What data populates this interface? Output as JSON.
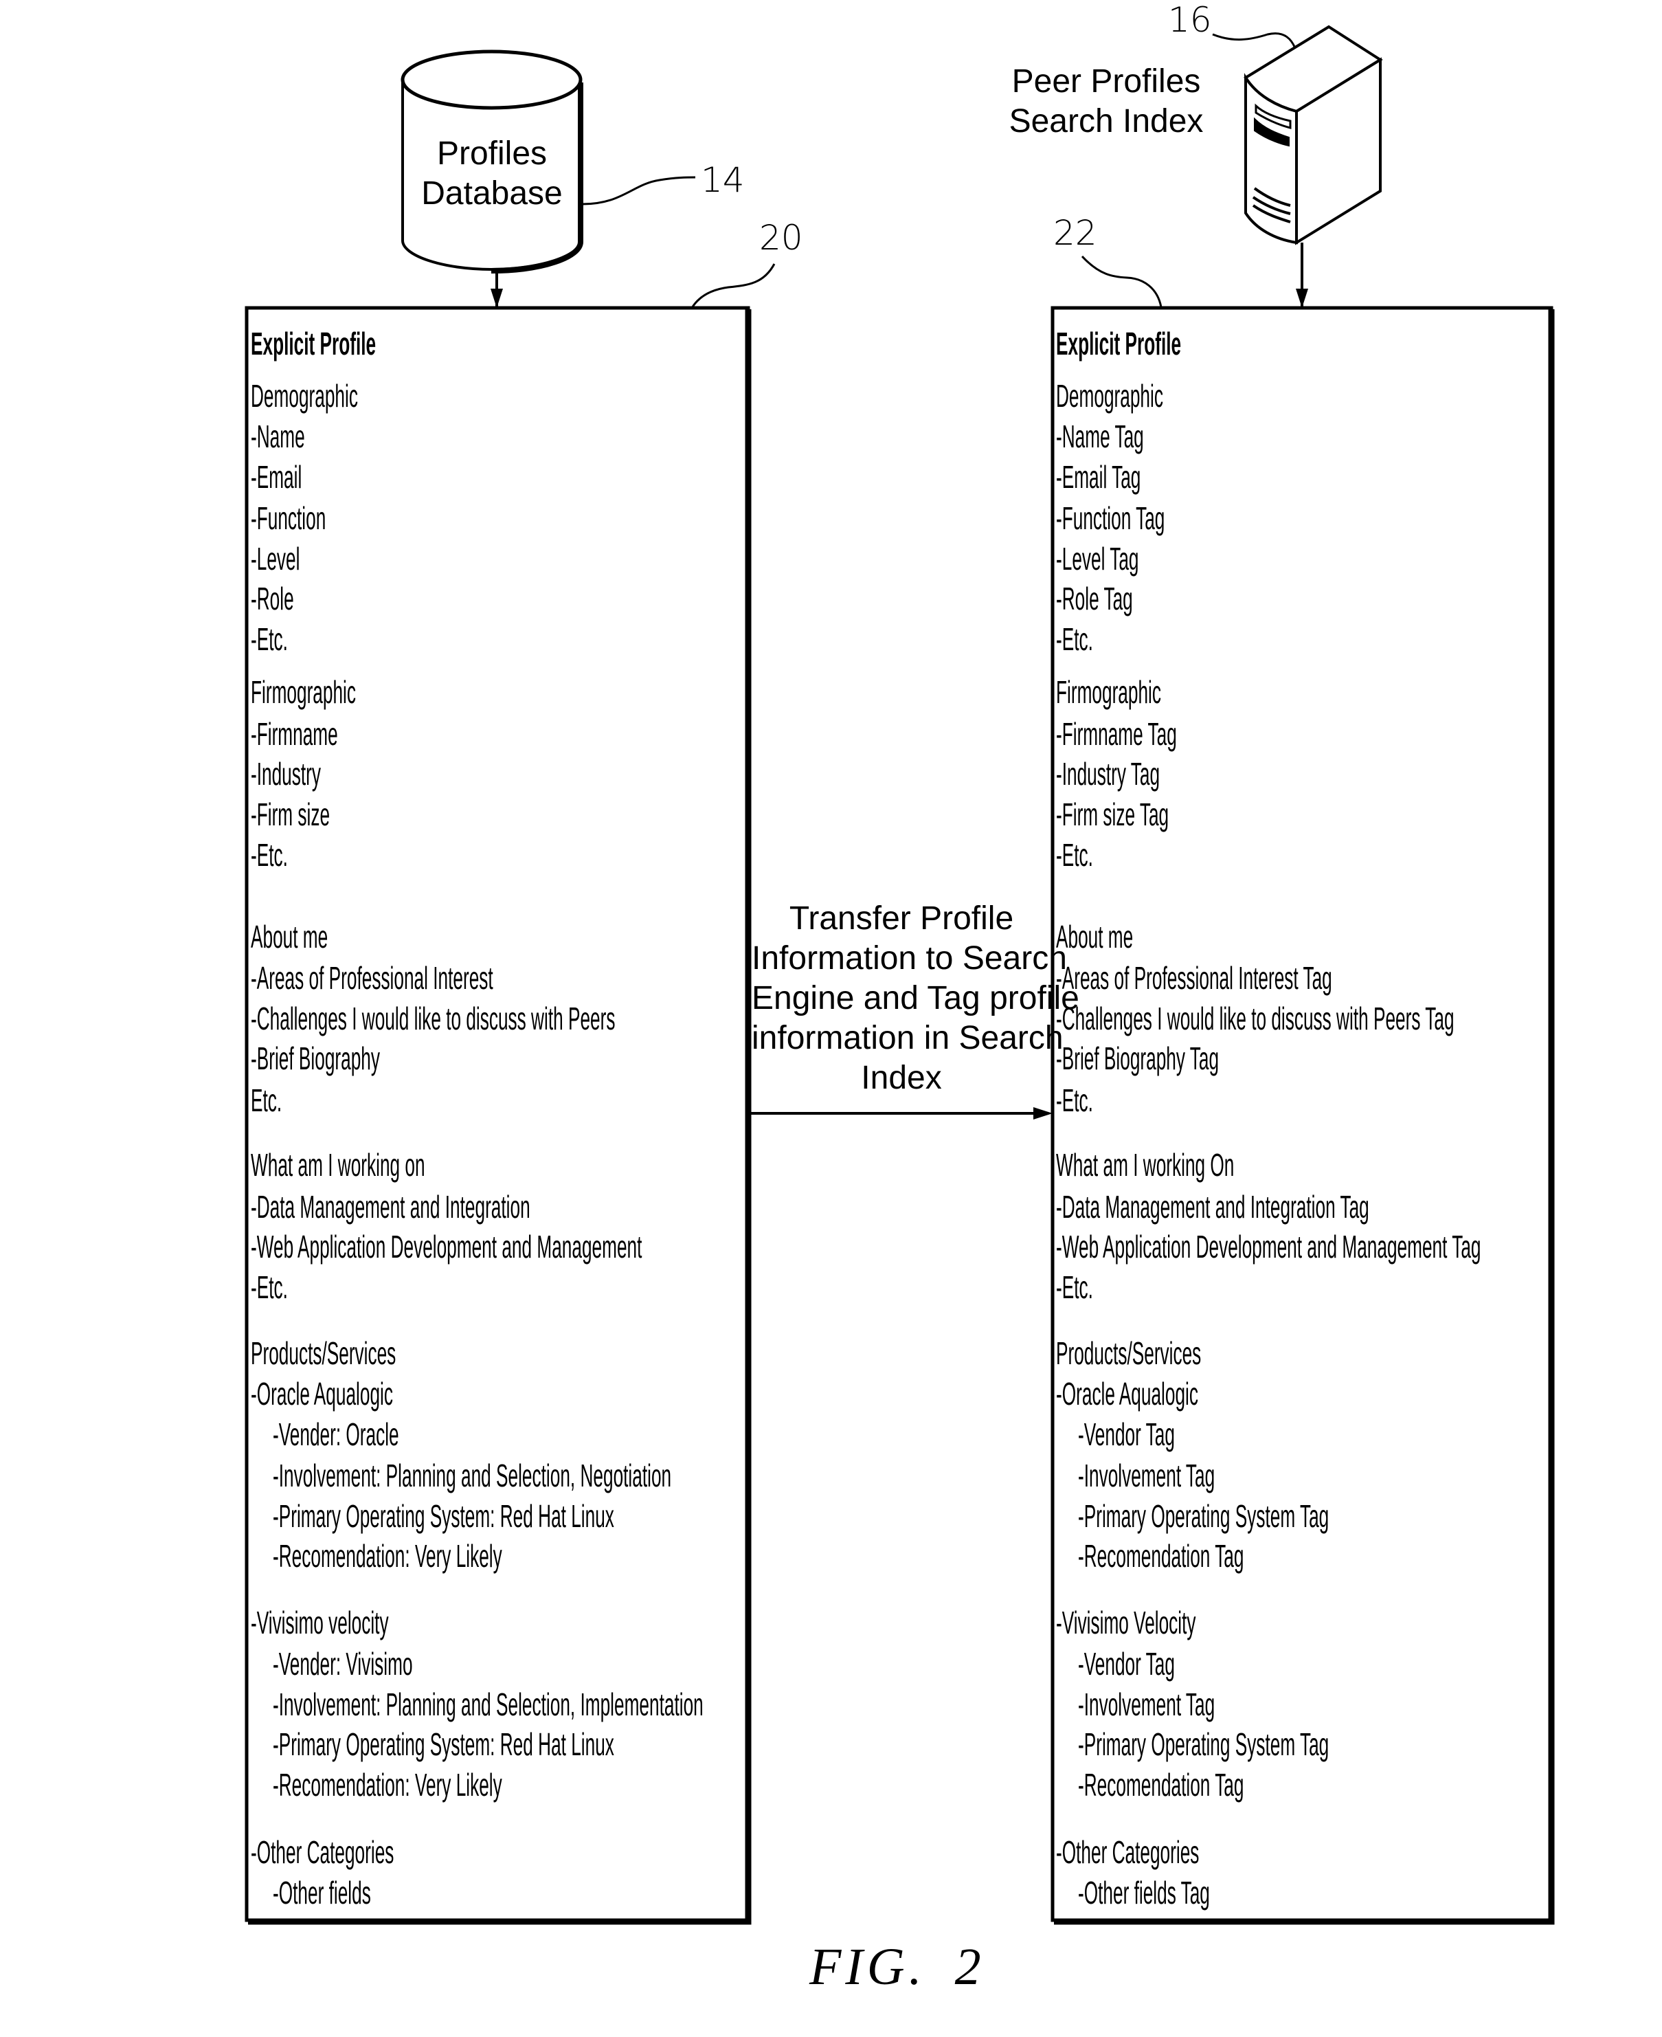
{
  "figure": {
    "label": "FIG.",
    "number": "2"
  },
  "nodes": {
    "profiles_database": {
      "line1": "Profiles",
      "line2": "Database",
      "ref": "14",
      "icon": "database-cylinder-icon"
    },
    "search_index": {
      "line1": "Peer Profiles",
      "line2": "Search Index",
      "ref": "16",
      "icon": "server-tower-icon"
    },
    "transfer": {
      "lines": [
        "Transfer Profile",
        "Information to Search",
        "Engine and Tag profile",
        "information in Search",
        "Index"
      ]
    }
  },
  "left_box": {
    "ref": "20",
    "lines": [
      {
        "text": "Explicit Profile",
        "bold": true,
        "indent": false
      },
      {
        "text": "Demographic",
        "bold": false,
        "indent": false
      },
      {
        "text": "-Name",
        "bold": false,
        "indent": false
      },
      {
        "text": "-Email",
        "bold": false,
        "indent": false
      },
      {
        "text": "-Function",
        "bold": false,
        "indent": false
      },
      {
        "text": "-Level",
        "bold": false,
        "indent": false
      },
      {
        "text": "-Role",
        "bold": false,
        "indent": false
      },
      {
        "text": "-Etc.",
        "bold": false,
        "indent": false
      },
      {
        "text": "Firmographic",
        "bold": false,
        "indent": false
      },
      {
        "text": "-Firmname",
        "bold": false,
        "indent": false
      },
      {
        "text": "-Industry",
        "bold": false,
        "indent": false
      },
      {
        "text": "-Firm size",
        "bold": false,
        "indent": false
      },
      {
        "text": "-Etc.",
        "bold": false,
        "indent": false
      },
      {
        "text": "About me",
        "bold": false,
        "indent": false
      },
      {
        "text": "-Areas of Professional Interest",
        "bold": false,
        "indent": false
      },
      {
        "text": "-Challenges I would like to discuss with Peers",
        "bold": false,
        "indent": false
      },
      {
        "text": "-Brief Biography",
        "bold": false,
        "indent": false
      },
      {
        "text": "Etc.",
        "bold": false,
        "indent": false
      },
      {
        "text": "What am I working on",
        "bold": false,
        "indent": false
      },
      {
        "text": "-Data Management and Integration",
        "bold": false,
        "indent": false
      },
      {
        "text": "-Web Application Development and Management",
        "bold": false,
        "indent": false
      },
      {
        "text": "-Etc.",
        "bold": false,
        "indent": false
      },
      {
        "text": "Products/Services",
        "bold": false,
        "indent": false
      },
      {
        "text": "-Oracle Aqualogic",
        "bold": false,
        "indent": false
      },
      {
        "text": "-Vender: Oracle",
        "bold": false,
        "indent": true
      },
      {
        "text": "-Involvement: Planning and Selection, Negotiation",
        "bold": false,
        "indent": true
      },
      {
        "text": "-Primary Operating System: Red Hat Linux",
        "bold": false,
        "indent": true
      },
      {
        "text": "-Recomendation: Very Likely",
        "bold": false,
        "indent": true
      },
      {
        "text": "-Vivisimo velocity",
        "bold": false,
        "indent": false
      },
      {
        "text": "-Vender: Vivisimo",
        "bold": false,
        "indent": true
      },
      {
        "text": "-Involvement: Planning and Selection, Implementation",
        "bold": false,
        "indent": true
      },
      {
        "text": "-Primary Operating System: Red Hat Linux",
        "bold": false,
        "indent": true
      },
      {
        "text": "-Recomendation: Very Likely",
        "bold": false,
        "indent": true
      },
      {
        "text": "-Other Categories",
        "bold": false,
        "indent": false
      },
      {
        "text": "-Other fields",
        "bold": false,
        "indent": true
      }
    ]
  },
  "right_box": {
    "ref": "22",
    "lines": [
      {
        "text": "Explicit Profile",
        "bold": true,
        "indent": false
      },
      {
        "text": "Demographic",
        "bold": false,
        "indent": false
      },
      {
        "text": "-Name Tag",
        "bold": false,
        "indent": false
      },
      {
        "text": "-Email Tag",
        "bold": false,
        "indent": false
      },
      {
        "text": "-Function Tag",
        "bold": false,
        "indent": false
      },
      {
        "text": "-Level Tag",
        "bold": false,
        "indent": false
      },
      {
        "text": "-Role Tag",
        "bold": false,
        "indent": false
      },
      {
        "text": "-Etc.",
        "bold": false,
        "indent": false
      },
      {
        "text": "Firmographic",
        "bold": false,
        "indent": false
      },
      {
        "text": "-Firmname Tag",
        "bold": false,
        "indent": false
      },
      {
        "text": "-Industry Tag",
        "bold": false,
        "indent": false
      },
      {
        "text": "-Firm size Tag",
        "bold": false,
        "indent": false
      },
      {
        "text": "-Etc.",
        "bold": false,
        "indent": false
      },
      {
        "text": "About me",
        "bold": false,
        "indent": false
      },
      {
        "text": "-Areas of Professional Interest Tag",
        "bold": false,
        "indent": false
      },
      {
        "text": "-Challenges I would like to discuss with Peers Tag",
        "bold": false,
        "indent": false
      },
      {
        "text": "-Brief Biography Tag",
        "bold": false,
        "indent": false
      },
      {
        "text": "-Etc.",
        "bold": false,
        "indent": false
      },
      {
        "text": "What am I working On",
        "bold": false,
        "indent": false
      },
      {
        "text": "-Data Management and Integration Tag",
        "bold": false,
        "indent": false
      },
      {
        "text": "-Web Application Development and Management Tag",
        "bold": false,
        "indent": false
      },
      {
        "text": "-Etc.",
        "bold": false,
        "indent": false
      },
      {
        "text": "Products/Services",
        "bold": false,
        "indent": false
      },
      {
        "text": "-Oracle Aqualogic",
        "bold": false,
        "indent": false
      },
      {
        "text": "-Vendor Tag",
        "bold": false,
        "indent": true
      },
      {
        "text": "-Involvement Tag",
        "bold": false,
        "indent": true
      },
      {
        "text": "-Primary Operating System Tag",
        "bold": false,
        "indent": true
      },
      {
        "text": "-Recomendation Tag",
        "bold": false,
        "indent": true
      },
      {
        "text": "-Vivisimo Velocity",
        "bold": false,
        "indent": false
      },
      {
        "text": "-Vendor Tag",
        "bold": false,
        "indent": true
      },
      {
        "text": "-Involvement Tag",
        "bold": false,
        "indent": true
      },
      {
        "text": "-Primary Operating System Tag",
        "bold": false,
        "indent": true
      },
      {
        "text": "-Recomendation Tag",
        "bold": false,
        "indent": true
      },
      {
        "text": "-Other Categories",
        "bold": false,
        "indent": false
      },
      {
        "text": "-Other fields Tag",
        "bold": false,
        "indent": true
      }
    ]
  }
}
